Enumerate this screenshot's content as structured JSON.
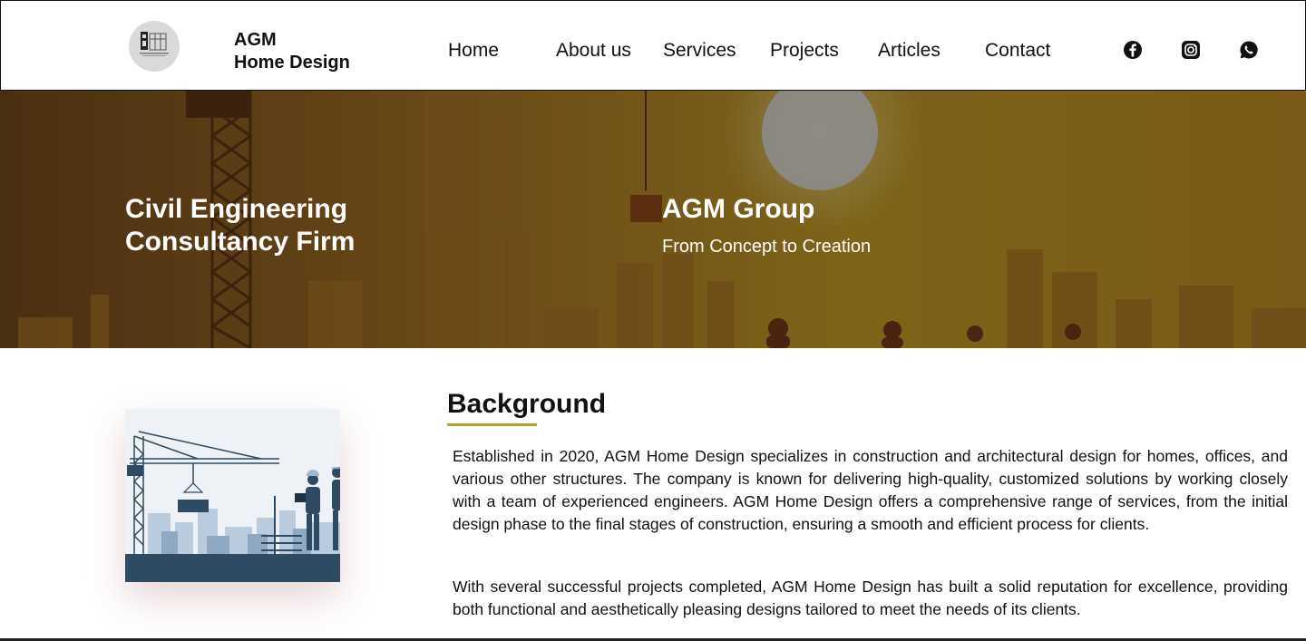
{
  "header": {
    "brand_line1": "AGM",
    "brand_line2": "Home Design",
    "nav": [
      "Home",
      "About us",
      "Services",
      "Projects",
      "Articles",
      "Contact"
    ],
    "social_icons": [
      "facebook-icon",
      "instagram-icon",
      "whatsapp-icon"
    ]
  },
  "hero": {
    "title_line1": "Civil Engineering",
    "title_line2": "Consultancy Firm",
    "group_name": "AGM Group",
    "tagline": "From Concept to Creation"
  },
  "background_section": {
    "heading": "Background",
    "paragraph1": "Established in 2020, AGM Home Design specializes in construction and architectural design for homes, offices, and various other structures. The company is known for delivering high-quality, customized solutions by working closely with a team of experienced engineers. AGM Home Design offers a comprehensive range of services, from the initial design phase to the final stages of construction, ensuring a smooth and efficient process for clients.",
    "paragraph2": "With several successful projects completed, AGM Home Design has built a solid reputation for excellence, providing both functional and aesthetically pleasing designs tailored to meet the needs of its clients."
  },
  "colors": {
    "accent_underline": "#b8a032",
    "hero_dark": "#4a2f12",
    "hero_gold": "#7d6418",
    "illustration_navy": "#2f4a63"
  }
}
